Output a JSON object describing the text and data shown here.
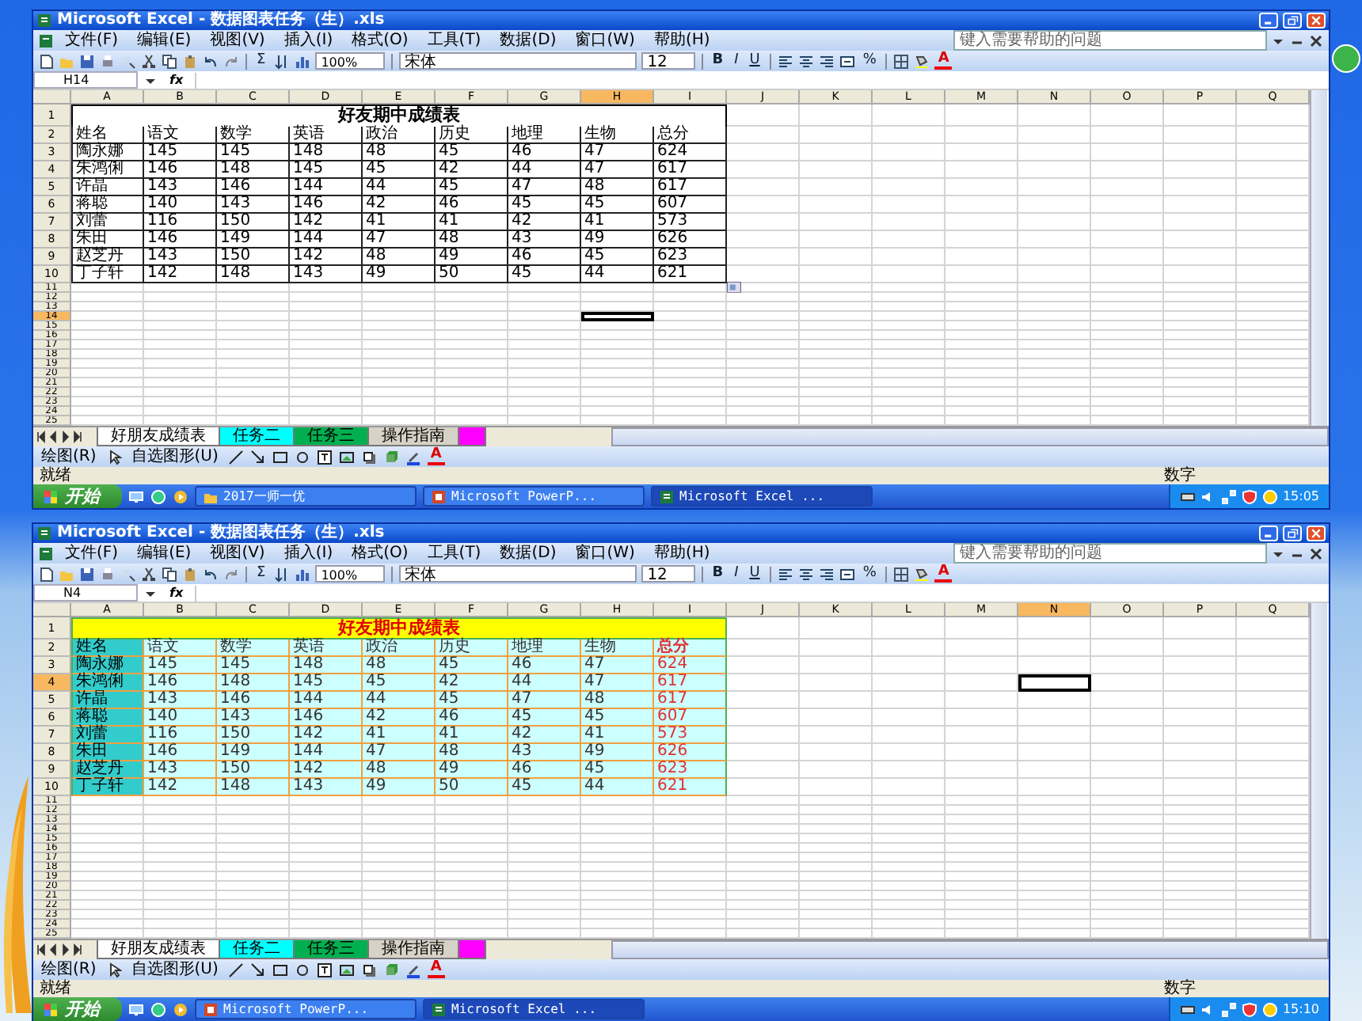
{
  "windows": [
    {
      "title": "Microsoft Excel - 数据图表任务（生）.xls",
      "menus": [
        "文件(F)",
        "编辑(E)",
        "视图(V)",
        "插入(I)",
        "格式(O)",
        "工具(T)",
        "数据(D)",
        "窗口(W)",
        "帮助(H)"
      ],
      "help_placeholder": "键入需要帮助的问题",
      "toolbar": {
        "sum": "Σ",
        "zoom": "100%",
        "font": "宋体",
        "size": "12",
        "bold": "B",
        "italic": "I",
        "underline": "U",
        "percent": "%",
        "font_color": "A"
      },
      "name_box": "H14",
      "formula_label": "fx",
      "grid": {
        "columns": [
          {
            "label": "A",
            "selected": false
          },
          {
            "label": "B",
            "selected": false
          },
          {
            "label": "C",
            "selected": false
          },
          {
            "label": "D",
            "selected": false
          },
          {
            "label": "E",
            "selected": false
          },
          {
            "label": "F",
            "selected": false
          },
          {
            "label": "G",
            "selected": false
          },
          {
            "label": "H",
            "selected": true
          },
          {
            "label": "I",
            "selected": false
          },
          {
            "label": "J",
            "selected": false
          },
          {
            "label": "K",
            "selected": false
          },
          {
            "label": "L",
            "selected": false
          },
          {
            "label": "M",
            "selected": false
          },
          {
            "label": "N",
            "selected": false
          },
          {
            "label": "O",
            "selected": false
          },
          {
            "label": "P",
            "selected": false
          },
          {
            "label": "Q",
            "selected": false
          }
        ],
        "rows": [
          {
            "label": "1",
            "selected": false
          },
          {
            "label": "2",
            "selected": false
          },
          {
            "label": "3",
            "selected": false
          },
          {
            "label": "4",
            "selected": false
          },
          {
            "label": "5",
            "selected": false
          },
          {
            "label": "6",
            "selected": false
          },
          {
            "label": "7",
            "selected": false
          },
          {
            "label": "8",
            "selected": false
          },
          {
            "label": "9",
            "selected": false
          },
          {
            "label": "10",
            "selected": false
          },
          {
            "label": "11",
            "selected": false
          },
          {
            "label": "12",
            "selected": false
          },
          {
            "label": "13",
            "selected": false
          },
          {
            "label": "14",
            "selected": true
          },
          {
            "label": "15",
            "selected": false
          },
          {
            "label": "16",
            "selected": false
          },
          {
            "label": "17",
            "selected": false
          },
          {
            "label": "18",
            "selected": false
          },
          {
            "label": "19",
            "selected": false
          },
          {
            "label": "20",
            "selected": false
          },
          {
            "label": "21",
            "selected": false
          },
          {
            "label": "22",
            "selected": false
          },
          {
            "label": "23",
            "selected": false
          },
          {
            "label": "24",
            "selected": false
          },
          {
            "label": "25",
            "selected": false
          }
        ]
      },
      "paste_options": true,
      "table": {
        "kind": "plain",
        "title": "好友期中成绩表",
        "header": [
          "姓名",
          "语文",
          "数学",
          "英语",
          "政治",
          "历史",
          "地理",
          "生物",
          "总分"
        ],
        "rows": [
          [
            "陶永娜",
            "145",
            "145",
            "148",
            "48",
            "45",
            "46",
            "47",
            "624"
          ],
          [
            "朱鸿俐",
            "146",
            "148",
            "145",
            "45",
            "42",
            "44",
            "47",
            "617"
          ],
          [
            "许晶",
            "143",
            "146",
            "144",
            "44",
            "45",
            "47",
            "48",
            "617"
          ],
          [
            "蒋聪",
            "140",
            "143",
            "146",
            "42",
            "46",
            "45",
            "45",
            "607"
          ],
          [
            "刘蕾",
            "116",
            "150",
            "142",
            "41",
            "41",
            "42",
            "41",
            "573"
          ],
          [
            "朱田",
            "146",
            "149",
            "144",
            "47",
            "48",
            "43",
            "49",
            "626"
          ],
          [
            "赵芝丹",
            "143",
            "150",
            "142",
            "48",
            "49",
            "46",
            "45",
            "623"
          ],
          [
            "丁子轩",
            "142",
            "148",
            "143",
            "49",
            "50",
            "45",
            "44",
            "621"
          ]
        ]
      },
      "sheet_tabs": [
        {
          "label": "好朋友成绩表",
          "selected": true
        },
        {
          "label": "任务二",
          "selected": false,
          "color": "#00ffff"
        },
        {
          "label": "任务三",
          "selected": false,
          "color": "#00b050"
        },
        {
          "label": "操作指南",
          "selected": false
        },
        {
          "selected": false,
          "color": "#ff00ff"
        }
      ],
      "drawing_toolbar": {
        "draw": "绘图(R)",
        "autoshapes": "自选图形(U)",
        "font_color": "A"
      },
      "status": {
        "left": "就绪",
        "right": "数字"
      },
      "taskbar": {
        "start": "开始",
        "items": [
          {
            "kind": "folder",
            "label": "2017一师一优",
            "selected": false
          },
          {
            "kind": "presentation",
            "label": "Microsoft PowerP...",
            "selected": false
          },
          {
            "kind": "spreadsheet",
            "label": "Microsoft Excel ...",
            "selected": true
          }
        ],
        "clock": "15:05"
      }
    },
    {
      "title": "Microsoft Excel - 数据图表任务（生）.xls",
      "menus": [
        "文件(F)",
        "编辑(E)",
        "视图(V)",
        "插入(I)",
        "格式(O)",
        "工具(T)",
        "数据(D)",
        "窗口(W)",
        "帮助(H)"
      ],
      "help_placeholder": "键入需要帮助的问题",
      "toolbar": {
        "sum": "Σ",
        "zoom": "100%",
        "font": "宋体",
        "size": "12",
        "bold": "B",
        "italic": "I",
        "underline": "U",
        "percent": "%",
        "font_color": "A"
      },
      "name_box": "N4",
      "formula_label": "fx",
      "grid": {
        "columns": [
          {
            "label": "A",
            "selected": false
          },
          {
            "label": "B",
            "selected": false
          },
          {
            "label": "C",
            "selected": false
          },
          {
            "label": "D",
            "selected": false
          },
          {
            "label": "E",
            "selected": false
          },
          {
            "label": "F",
            "selected": false
          },
          {
            "label": "G",
            "selected": false
          },
          {
            "label": "H",
            "selected": false
          },
          {
            "label": "I",
            "selected": false
          },
          {
            "label": "J",
            "selected": false
          },
          {
            "label": "K",
            "selected": false
          },
          {
            "label": "L",
            "selected": false
          },
          {
            "label": "M",
            "selected": false
          },
          {
            "label": "N",
            "selected": true
          },
          {
            "label": "O",
            "selected": false
          },
          {
            "label": "P",
            "selected": false
          },
          {
            "label": "Q",
            "selected": false
          }
        ],
        "rows": [
          {
            "label": "1",
            "selected": false
          },
          {
            "label": "2",
            "selected": false
          },
          {
            "label": "3",
            "selected": false
          },
          {
            "label": "4",
            "selected": true
          },
          {
            "label": "5",
            "selected": false
          },
          {
            "label": "6",
            "selected": false
          },
          {
            "label": "7",
            "selected": false
          },
          {
            "label": "8",
            "selected": false
          },
          {
            "label": "9",
            "selected": false
          },
          {
            "label": "10",
            "selected": false
          },
          {
            "label": "11",
            "selected": false
          },
          {
            "label": "12",
            "selected": false
          },
          {
            "label": "13",
            "selected": false
          },
          {
            "label": "14",
            "selected": false
          },
          {
            "label": "15",
            "selected": false
          },
          {
            "label": "16",
            "selected": false
          },
          {
            "label": "17",
            "selected": false
          },
          {
            "label": "18",
            "selected": false
          },
          {
            "label": "19",
            "selected": false
          },
          {
            "label": "20",
            "selected": false
          },
          {
            "label": "21",
            "selected": false
          },
          {
            "label": "22",
            "selected": false
          },
          {
            "label": "23",
            "selected": false
          },
          {
            "label": "24",
            "selected": false
          },
          {
            "label": "25",
            "selected": false
          }
        ]
      },
      "table": {
        "kind": "formatted",
        "title": "好友期中成绩表",
        "header": [
          "姓名",
          "语文",
          "数学",
          "英语",
          "政治",
          "历史",
          "地理",
          "生物",
          "总分"
        ],
        "rows": [
          [
            "陶永娜",
            "145",
            "145",
            "148",
            "48",
            "45",
            "46",
            "47",
            "624"
          ],
          [
            "朱鸿俐",
            "146",
            "148",
            "145",
            "45",
            "42",
            "44",
            "47",
            "617"
          ],
          [
            "许晶",
            "143",
            "146",
            "144",
            "44",
            "45",
            "47",
            "48",
            "617"
          ],
          [
            "蒋聪",
            "140",
            "143",
            "146",
            "42",
            "46",
            "45",
            "45",
            "607"
          ],
          [
            "刘蕾",
            "116",
            "150",
            "142",
            "41",
            "41",
            "42",
            "41",
            "573"
          ],
          [
            "朱田",
            "146",
            "149",
            "144",
            "47",
            "48",
            "43",
            "49",
            "626"
          ],
          [
            "赵芝丹",
            "143",
            "150",
            "142",
            "48",
            "49",
            "46",
            "45",
            "623"
          ],
          [
            "丁子轩",
            "142",
            "148",
            "143",
            "49",
            "50",
            "45",
            "44",
            "621"
          ]
        ]
      },
      "sheet_tabs": [
        {
          "label": "好朋友成绩表",
          "selected": true
        },
        {
          "label": "任务二",
          "selected": false,
          "color": "#00ffff"
        },
        {
          "label": "任务三",
          "selected": false,
          "color": "#00b050"
        },
        {
          "label": "操作指南",
          "selected": false
        },
        {
          "selected": false,
          "color": "#ff00ff"
        }
      ],
      "drawing_toolbar": {
        "draw": "绘图(R)",
        "autoshapes": "自选图形(U)",
        "font_color": "A"
      },
      "status": {
        "left": "就绪",
        "right": "数字"
      },
      "taskbar": {
        "start": "开始",
        "items": [
          {
            "kind": "presentation",
            "label": "Microsoft PowerP...",
            "selected": false
          },
          {
            "kind": "spreadsheet",
            "label": "Microsoft Excel ...",
            "selected": true
          }
        ],
        "clock": "15:10"
      }
    }
  ]
}
